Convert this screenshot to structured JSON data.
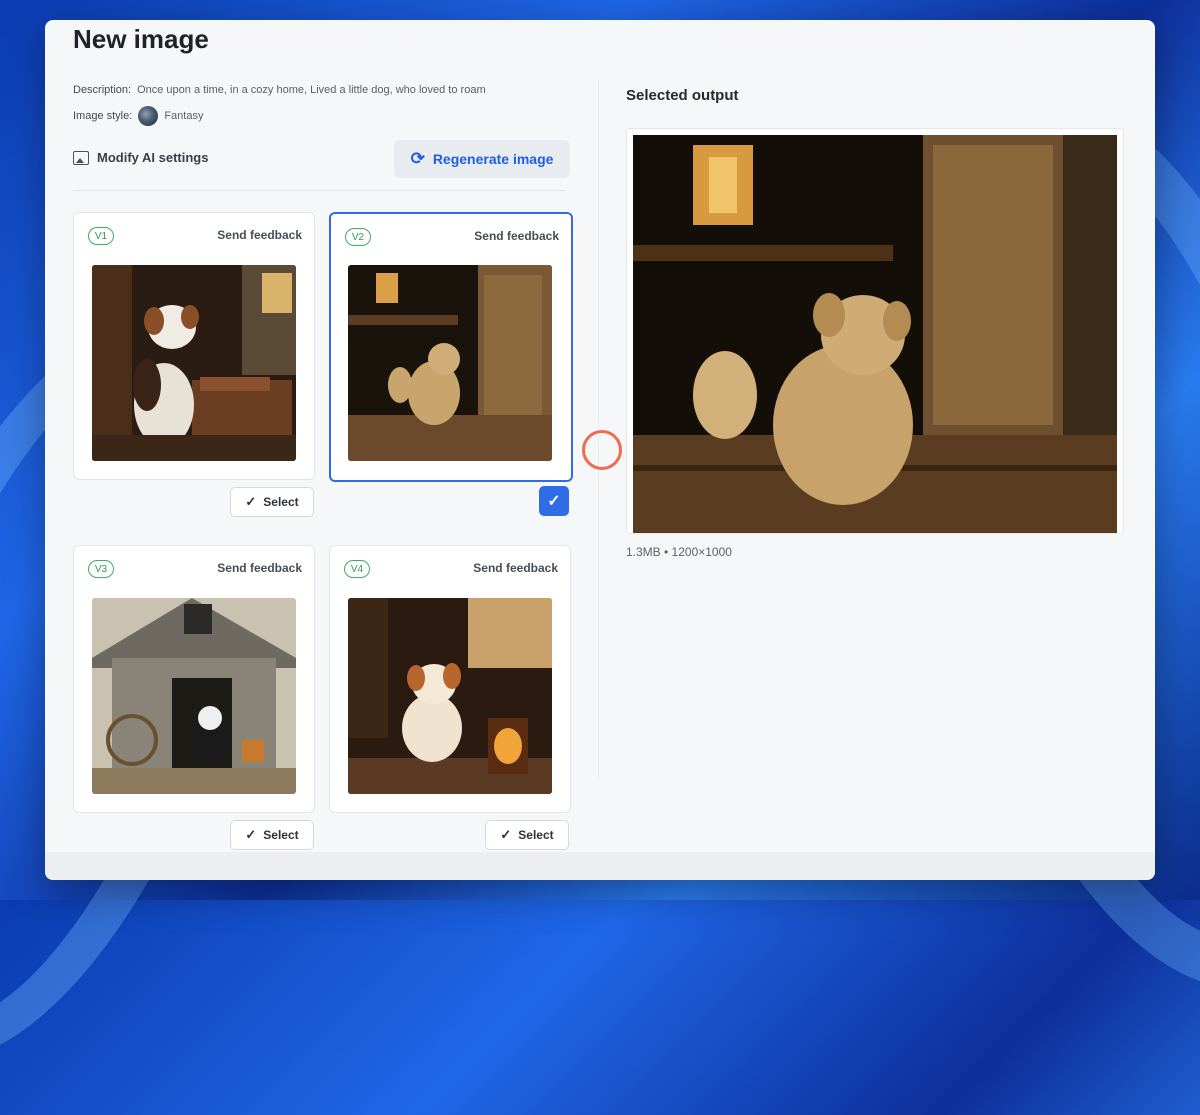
{
  "page": {
    "title": "New image",
    "description_label": "Description:",
    "description_value": "Once upon a time, in a cozy home, Lived a little dog, who loved to roam",
    "style_label": "Image style:",
    "style_value": "Fantasy",
    "modify_label": "Modify AI settings",
    "regenerate_label": "Regenerate image"
  },
  "variants": [
    {
      "badge": "V1",
      "feedback": "Send feedback",
      "select_label": "Select",
      "selected": false
    },
    {
      "badge": "V2",
      "feedback": "Send feedback",
      "select_label": "",
      "selected": true
    },
    {
      "badge": "V3",
      "feedback": "Send feedback",
      "select_label": "Select",
      "selected": false
    },
    {
      "badge": "V4",
      "feedback": "Send feedback",
      "select_label": "Select",
      "selected": false
    }
  ],
  "output": {
    "title": "Selected output",
    "file_info": "1.3MB • 1200×1000"
  },
  "icons": {
    "regenerate": "refresh-icon",
    "modify": "image-settings-icon",
    "check": "check-icon"
  },
  "colors": {
    "accent": "#2f6de6",
    "badge_green": "#3fae5d",
    "ring": "#f06b50"
  }
}
